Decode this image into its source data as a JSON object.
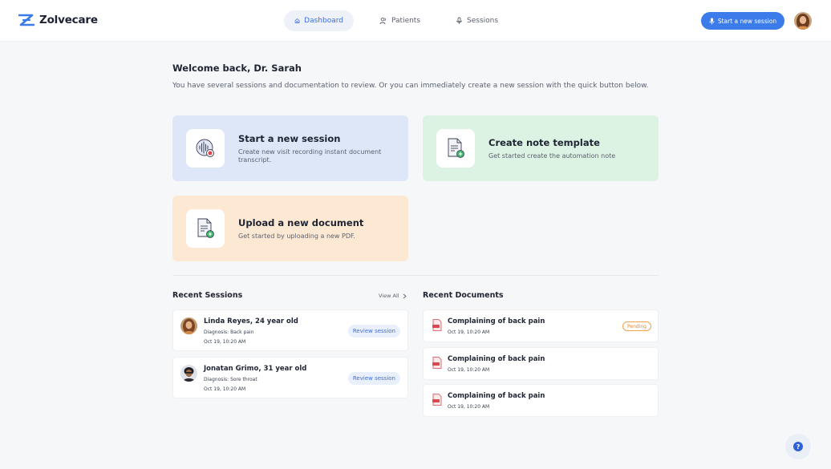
{
  "app": {
    "name": "Zolvecare"
  },
  "nav": {
    "items": [
      {
        "label": "Dashboard",
        "icon": "home-icon",
        "active": true
      },
      {
        "label": "Patients",
        "icon": "users-icon",
        "active": false
      },
      {
        "label": "Sessions",
        "icon": "microphone-icon",
        "active": false
      }
    ]
  },
  "header": {
    "cta_label": "Start a new session",
    "accent": "#3b7bea"
  },
  "main": {
    "welcome": "Welcome back, Dr. Sarah",
    "intro": "You have several sessions and documentation to review. Or you can immediately create a new session with the quick button below."
  },
  "cards": {
    "session": {
      "title": "Start a new session",
      "desc": "Create new visit recording instant document transcript."
    },
    "template": {
      "title": "Create note template",
      "desc": "Get started create the automation note"
    },
    "upload": {
      "title": "Upload a new document",
      "desc": "Get started by uploading a new PDF."
    }
  },
  "recent_sessions": {
    "title": "Recent Sessions",
    "view_all": "View All",
    "rows": [
      {
        "name": "Linda Reyes, 24 year old",
        "diagnosis": "Diagnosis: Back pain",
        "date": "Oct 19, 10:20 AM",
        "action": "Review session"
      },
      {
        "name": "Jonatan Grimo, 31 year old",
        "diagnosis": "Diagnosis: Sore throat",
        "date": "Oct 19, 10:20 AM",
        "action": "Review session"
      }
    ]
  },
  "recent_documents": {
    "title": "Recent Documents",
    "rows": [
      {
        "title": "Complaining of back pain",
        "date": "Oct 19, 10:20 AM",
        "status": "Pending"
      },
      {
        "title": "Complaining of back pain",
        "date": "Oct 19, 10:20 AM"
      },
      {
        "title": "Complaining of back pain",
        "date": "Oct 19, 10:20 AM"
      }
    ]
  },
  "help": {
    "label": "?"
  }
}
